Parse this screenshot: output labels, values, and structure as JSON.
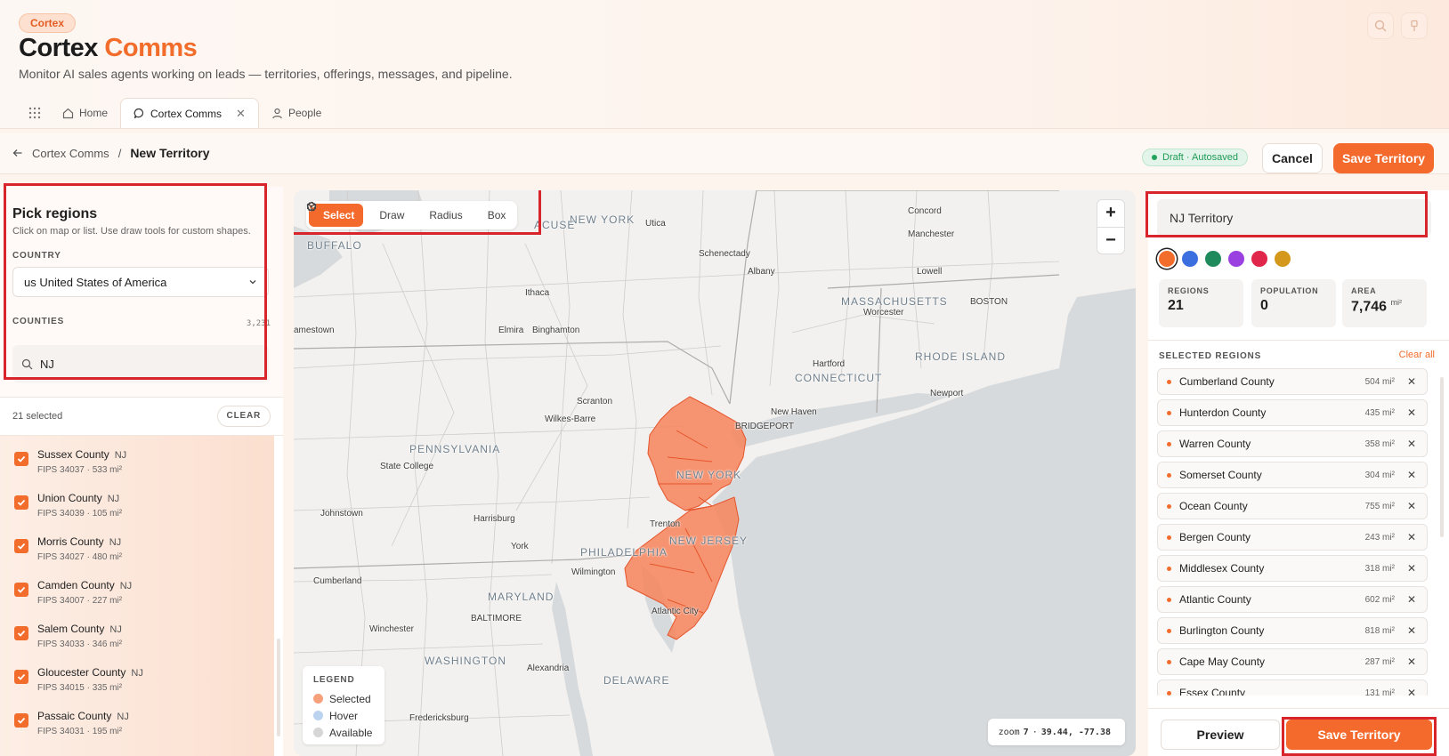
{
  "header": {
    "badge": "Cortex",
    "title_main": "Cortex",
    "title_accent": "Comms",
    "subtitle": "Monitor AI sales agents working on leads — territories, offerings, messages, and pipeline."
  },
  "tabs": [
    {
      "label": "Home",
      "icon": "home-icon",
      "active": false
    },
    {
      "label": "Cortex Comms",
      "icon": "chat-bubble-icon",
      "active": true
    },
    {
      "label": "People",
      "icon": "person-icon",
      "active": false
    }
  ],
  "breadcrumb": {
    "parent": "Cortex Comms",
    "separator": "/",
    "current": "New Territory"
  },
  "status": {
    "draft": "Draft · Autosaved"
  },
  "actions": {
    "cancel": "Cancel",
    "save": "Save Territory"
  },
  "left": {
    "title": "Pick regions",
    "subtitle": "Click on map or list. Use draw tools for custom shapes.",
    "country_label": "COUNTRY",
    "country_value": "us United States of America",
    "counties_label": "COUNTIES",
    "counties_total": "3,231",
    "search_value": "NJ",
    "selected_count": "21 selected",
    "clear": "CLEAR",
    "counties": [
      {
        "name": "Sussex County",
        "state": "NJ",
        "meta": "FIPS 34037 · 533 mi²"
      },
      {
        "name": "Union County",
        "state": "NJ",
        "meta": "FIPS 34039 · 105 mi²"
      },
      {
        "name": "Morris County",
        "state": "NJ",
        "meta": "FIPS 34027 · 480 mi²"
      },
      {
        "name": "Camden County",
        "state": "NJ",
        "meta": "FIPS 34007 · 227 mi²"
      },
      {
        "name": "Salem County",
        "state": "NJ",
        "meta": "FIPS 34033 · 346 mi²"
      },
      {
        "name": "Gloucester County",
        "state": "NJ",
        "meta": "FIPS 34015 · 335 mi²"
      },
      {
        "name": "Passaic County",
        "state": "NJ",
        "meta": "FIPS 34031 · 195 mi²"
      }
    ]
  },
  "tools": [
    {
      "label": "Select",
      "icon": "cursor-icon",
      "active": true
    },
    {
      "label": "Draw",
      "icon": "polygon-icon",
      "active": false
    },
    {
      "label": "Radius",
      "icon": "radius-icon",
      "active": false
    },
    {
      "label": "Box",
      "icon": "box-icon",
      "active": false
    }
  ],
  "map": {
    "zoom_in": "+",
    "zoom_out": "−",
    "labels": [
      "NEW YORK",
      "Utica",
      "Concord",
      "Manchester",
      "Schenectady",
      "Albany",
      "Lowell",
      "BOSTON",
      "MASSACHUSETTS",
      "Worcester",
      "Ithaca",
      "Elmira",
      "Binghamton",
      "Hartford",
      "CONNECTICUT",
      "RHODE ISLAND",
      "Newport",
      "Scranton",
      "Wilkes-Barre",
      "New Haven",
      "BRIDGEPORT",
      "PENNSYLVANIA",
      "State College",
      "NEW YORK",
      "Johnstown",
      "Harrisburg",
      "Trenton",
      "NEW JERSEY",
      "York",
      "PHILADELPHIA",
      "Wilmington",
      "Cumberland",
      "MARYLAND",
      "BALTIMORE",
      "Atlantic City",
      "Winchester",
      "WASHINGTON",
      "Alexandria",
      "DELAWARE",
      "Fredericksburg",
      "BUFFALO",
      "ACUSE",
      "amestown"
    ],
    "legend": {
      "title": "LEGEND",
      "items": [
        {
          "label": "Selected",
          "color": "#f7a07c"
        },
        {
          "label": "Hover",
          "color": "#bcd3ef"
        },
        {
          "label": "Available",
          "color": "#d6d6d6"
        }
      ]
    },
    "readout": {
      "zoom_label": "zoom",
      "zoom": "7",
      "sep": "·",
      "coords": "39.44, -77.38"
    }
  },
  "territory": {
    "name": "NJ Territory",
    "colors": [
      "#f26d2b",
      "#3b6fe0",
      "#1f8a5b",
      "#9a3fe0",
      "#e0264a",
      "#d3981c"
    ],
    "stats": [
      {
        "label": "REGIONS",
        "value": "21",
        "unit": ""
      },
      {
        "label": "POPULATION",
        "value": "0",
        "unit": ""
      },
      {
        "label": "AREA",
        "value": "7,746",
        "unit": "mi²"
      }
    ],
    "selected_label": "SELECTED REGIONS",
    "clear_all": "Clear all",
    "regions": [
      {
        "name": "Cumberland County",
        "area": "504 mi²"
      },
      {
        "name": "Hunterdon County",
        "area": "435 mi²"
      },
      {
        "name": "Warren County",
        "area": "358 mi²"
      },
      {
        "name": "Somerset County",
        "area": "304 mi²"
      },
      {
        "name": "Ocean County",
        "area": "755 mi²"
      },
      {
        "name": "Bergen County",
        "area": "243 mi²"
      },
      {
        "name": "Middlesex County",
        "area": "318 mi²"
      },
      {
        "name": "Atlantic County",
        "area": "602 mi²"
      },
      {
        "name": "Burlington County",
        "area": "818 mi²"
      },
      {
        "name": "Cape May County",
        "area": "287 mi²"
      },
      {
        "name": "Essex County",
        "area": "131 mi²"
      }
    ],
    "preview": "Preview",
    "save": "Save Territory"
  }
}
